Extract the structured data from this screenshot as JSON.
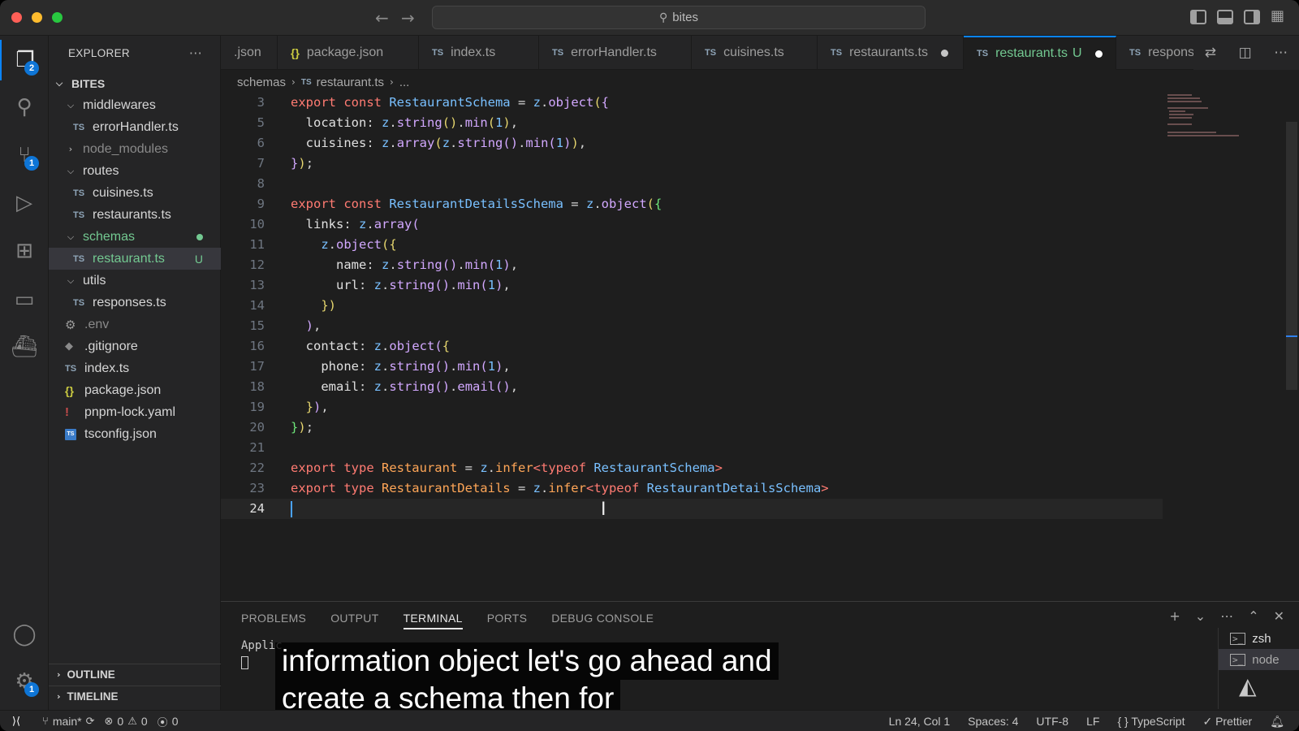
{
  "titlebar": {
    "search_text": "bites"
  },
  "activity_badges": {
    "explorer": "2",
    "scm": "1",
    "settings": "1"
  },
  "sidebar": {
    "title": "EXPLORER",
    "more": "···",
    "root": "BITES",
    "items": [
      {
        "label": "middlewares",
        "kind": "folder"
      },
      {
        "label": "errorHandler.ts",
        "kind": "ts"
      },
      {
        "label": "node_modules",
        "kind": "folder-closed"
      },
      {
        "label": "routes",
        "kind": "folder"
      },
      {
        "label": "cuisines.ts",
        "kind": "ts"
      },
      {
        "label": "restaurants.ts",
        "kind": "ts"
      },
      {
        "label": "schemas",
        "kind": "folder"
      },
      {
        "label": "restaurant.ts",
        "kind": "ts",
        "status": "U"
      },
      {
        "label": "utils",
        "kind": "folder"
      },
      {
        "label": "responses.ts",
        "kind": "ts"
      },
      {
        "label": ".env",
        "kind": "env"
      },
      {
        "label": ".gitignore",
        "kind": "git"
      },
      {
        "label": "index.ts",
        "kind": "ts"
      },
      {
        "label": "package.json",
        "kind": "json"
      },
      {
        "label": "pnpm-lock.yaml",
        "kind": "yaml"
      },
      {
        "label": "tsconfig.json",
        "kind": "tsconfig"
      }
    ],
    "outline": "OUTLINE",
    "timeline": "TIMELINE"
  },
  "tabs": [
    {
      "label": ".json",
      "icon": ""
    },
    {
      "label": "package.json",
      "icon": "{}"
    },
    {
      "label": "index.ts",
      "icon": "TS"
    },
    {
      "label": "errorHandler.ts",
      "icon": "TS"
    },
    {
      "label": "cuisines.ts",
      "icon": "TS"
    },
    {
      "label": "restaurants.ts",
      "icon": "TS",
      "modified": true
    },
    {
      "label": "restaurant.ts",
      "icon": "TS",
      "status": "U",
      "modified": true,
      "active": true
    },
    {
      "label": "respons",
      "icon": "TS"
    }
  ],
  "breadcrumb": {
    "folder": "schemas",
    "file": "restaurant.ts",
    "tail": "..."
  },
  "editor": {
    "line_numbers": [
      "3",
      "5",
      "6",
      "7",
      "8",
      "9",
      "10",
      "11",
      "12",
      "13",
      "14",
      "15",
      "16",
      "17",
      "18",
      "19",
      "20",
      "21",
      "22",
      "23",
      "24"
    ],
    "lines": [
      "export const RestaurantSchema = z.object({",
      "  location: z.string().min(1),",
      "  cuisines: z.array(z.string().min(1)),",
      "});",
      "",
      "export const RestaurantDetailsSchema = z.object({",
      "  links: z.array(",
      "    z.object({",
      "      name: z.string().min(1),",
      "      url: z.string().min(1),",
      "    })",
      "  ),",
      "  contact: z.object({",
      "    phone: z.string().min(1),",
      "    email: z.string().email(),",
      "  }),",
      "});",
      "",
      "export type Restaurant = z.infer<typeof RestaurantSchema>",
      "export type RestaurantDetails = z.infer<typeof RestaurantDetailsSchema>",
      ""
    ],
    "cursor": {
      "line": "24"
    }
  },
  "panel": {
    "tabs": [
      "PROBLEMS",
      "OUTPUT",
      "TERMINAL",
      "PORTS",
      "DEBUG CONSOLE"
    ],
    "active_tab": "TERMINAL",
    "terminal_text": "Applic",
    "terminals": [
      "zsh",
      "node"
    ]
  },
  "captions": {
    "line1": "information object let's go ahead and",
    "line2": "create a schema then for"
  },
  "statusbar": {
    "branch": "main*",
    "errors": "0",
    "warnings": "0",
    "ports": "0",
    "position": "Ln 24, Col 1",
    "spaces": "Spaces: 4",
    "encoding": "UTF-8",
    "eol": "LF",
    "language": "TypeScript",
    "formatter": "Prettier"
  },
  "colors": {
    "accent": "#0a84ff",
    "untracked": "#73c991",
    "keyword": "#ff7b72"
  }
}
